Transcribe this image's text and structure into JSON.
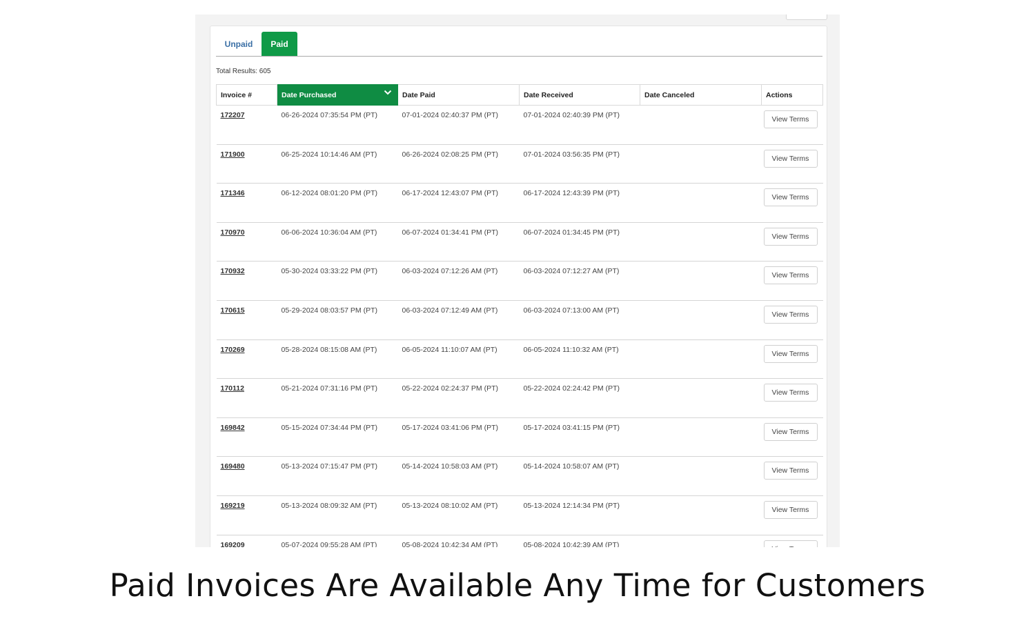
{
  "tabs": {
    "unpaid": "Unpaid",
    "paid": "Paid"
  },
  "total_results": "Total Results: 605",
  "columns": [
    "Invoice #",
    "Date Purchased",
    "Date Paid",
    "Date Received",
    "Date Canceled",
    "Actions"
  ],
  "sort_icon": "chevron-down-icon",
  "accent_color": "#0f8c43",
  "rows": [
    {
      "invoice": "172207",
      "purchased": "06-26-2024 07:35:54 PM (PT)",
      "paid": "07-01-2024 02:40:37 PM (PT)",
      "received": "07-01-2024 02:40:39 PM (PT)",
      "canceled": "",
      "action": "View Terms"
    },
    {
      "invoice": "171900",
      "purchased": "06-25-2024 10:14:46 AM (PT)",
      "paid": "06-26-2024 02:08:25 PM (PT)",
      "received": "07-01-2024 03:56:35 PM (PT)",
      "canceled": "",
      "action": "View Terms"
    },
    {
      "invoice": "171346",
      "purchased": "06-12-2024 08:01:20 PM (PT)",
      "paid": "06-17-2024 12:43:07 PM (PT)",
      "received": "06-17-2024 12:43:39 PM (PT)",
      "canceled": "",
      "action": "View Terms"
    },
    {
      "invoice": "170970",
      "purchased": "06-06-2024 10:36:04 AM (PT)",
      "paid": "06-07-2024 01:34:41 PM (PT)",
      "received": "06-07-2024 01:34:45 PM (PT)",
      "canceled": "",
      "action": "View Terms"
    },
    {
      "invoice": "170932",
      "purchased": "05-30-2024 03:33:22 PM (PT)",
      "paid": "06-03-2024 07:12:26 AM (PT)",
      "received": "06-03-2024 07:12:27 AM (PT)",
      "canceled": "",
      "action": "View Terms"
    },
    {
      "invoice": "170615",
      "purchased": "05-29-2024 08:03:57 PM (PT)",
      "paid": "06-03-2024 07:12:49 AM (PT)",
      "received": "06-03-2024 07:13:00 AM (PT)",
      "canceled": "",
      "action": "View Terms"
    },
    {
      "invoice": "170269",
      "purchased": "05-28-2024 08:15:08 AM (PT)",
      "paid": "06-05-2024 11:10:07 AM (PT)",
      "received": "06-05-2024 11:10:32 AM (PT)",
      "canceled": "",
      "action": "View Terms"
    },
    {
      "invoice": "170112",
      "purchased": "05-21-2024 07:31:16 PM (PT)",
      "paid": "05-22-2024 02:24:37 PM (PT)",
      "received": "05-22-2024 02:24:42 PM (PT)",
      "canceled": "",
      "action": "View Terms"
    },
    {
      "invoice": "169842",
      "purchased": "05-15-2024 07:34:44 PM (PT)",
      "paid": "05-17-2024 03:41:06 PM (PT)",
      "received": "05-17-2024 03:41:15 PM (PT)",
      "canceled": "",
      "action": "View Terms"
    },
    {
      "invoice": "169480",
      "purchased": "05-13-2024 07:15:47 PM (PT)",
      "paid": "05-14-2024 10:58:03 AM (PT)",
      "received": "05-14-2024 10:58:07 AM (PT)",
      "canceled": "",
      "action": "View Terms"
    },
    {
      "invoice": "169219",
      "purchased": "05-13-2024 08:09:32 AM (PT)",
      "paid": "05-13-2024 08:10:02 AM (PT)",
      "received": "05-13-2024 12:14:34 PM (PT)",
      "canceled": "",
      "action": "View Terms"
    },
    {
      "invoice": "169209",
      "purchased": "05-07-2024 09:55:28 AM (PT)",
      "paid": "05-08-2024 10:42:34 AM (PT)",
      "received": "05-08-2024 10:42:39 AM (PT)",
      "canceled": "",
      "action": "View Terms"
    }
  ],
  "caption": "Paid Invoices Are Available Any Time for Customers"
}
